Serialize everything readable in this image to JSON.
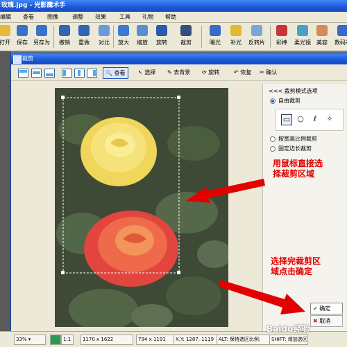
{
  "app": {
    "title": "玫瑰.jpg - 光影魔术手"
  },
  "menu": [
    "编辑",
    "查看",
    "图像",
    "调整",
    "效果",
    "工具",
    "礼物",
    "帮助"
  ],
  "toolbar": [
    {
      "label": "打开",
      "icon": "folder-icon",
      "color": "#e8b83a"
    },
    {
      "label": "保存",
      "icon": "save-icon",
      "color": "#3a72c8"
    },
    {
      "label": "另存为",
      "icon": "save-as-icon",
      "color": "#3a72c8"
    },
    {
      "label": "撤销",
      "icon": "undo-icon",
      "color": "#2f64b8"
    },
    {
      "label": "重做",
      "icon": "redo-icon",
      "color": "#2f64b8"
    },
    {
      "label": "对比",
      "icon": "compare-icon",
      "color": "#6a9ad8"
    },
    {
      "label": "放大",
      "icon": "zoom-in-icon",
      "color": "#3b7ad0"
    },
    {
      "label": "缩放",
      "icon": "resize-icon",
      "color": "#5a8fd0"
    },
    {
      "label": "旋转",
      "icon": "rotate-icon",
      "color": "#2a5ab0"
    },
    {
      "label": "裁剪",
      "icon": "crop-icon",
      "color": "#34507a"
    },
    {
      "label": "曝光",
      "icon": "exposure-icon",
      "color": "#3a6ac8"
    },
    {
      "label": "补光",
      "icon": "fill-light-icon",
      "color": "#e3b92f"
    },
    {
      "label": "反转片",
      "icon": "reverse-film-icon",
      "color": "#7aa6d8"
    },
    {
      "label": "彩棒",
      "icon": "color-wand-icon",
      "color": "#c8343a"
    },
    {
      "label": "柔光镜",
      "icon": "soft-light-icon",
      "color": "#4aa0c8"
    },
    {
      "label": "美容",
      "icon": "beauty-icon",
      "color": "#d68a58"
    },
    {
      "label": "数码补",
      "icon": "digital-fix-icon",
      "color": "#3a6ac8"
    }
  ],
  "dialog": {
    "title": "裁剪",
    "tools": {
      "view": "查看",
      "select": "选择",
      "remove_bg": "去背景",
      "rotate": "旋转",
      "restore": "恢复",
      "confirm": "确认"
    },
    "panel": {
      "title": "<<< 裁剪模式选项",
      "free_crop": "自由裁剪",
      "ratio_crop": "按宽高比例裁剪",
      "fixed_crop": "固定边长裁剪"
    },
    "ok_label": "确定",
    "cancel_label": "取消"
  },
  "annotations": {
    "one": "用鼠标直接选\n择裁剪区域",
    "two": "选择完裁剪区\n域点击确定"
  },
  "status": {
    "zoom": "33%",
    "ratio": "1:1",
    "image_size": "1170 x 1622",
    "selection_size": "794 x 1191",
    "coords": "X,Y: 1287, 1119",
    "hint": "ALT: 保持选区比例;",
    "shift_hint": "SHIFT: 增加选区"
  },
  "colors": {
    "accent": "#1c58d8",
    "annotation": "#e20000"
  },
  "watermark": "Baidu经验"
}
